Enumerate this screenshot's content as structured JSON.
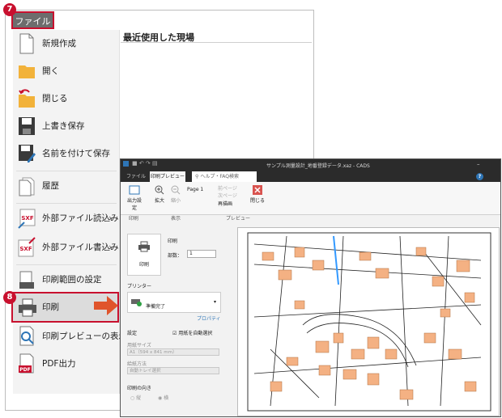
{
  "file_window": {
    "tab_label": "ファイル",
    "recent_heading": "最近使用した現場",
    "menu_items": [
      {
        "label": "新規作成",
        "icon": "new-document-icon"
      },
      {
        "label": "開く",
        "icon": "folder-icon"
      },
      {
        "label": "閉じる",
        "icon": "close-folder-icon"
      },
      {
        "label": "上書き保存",
        "icon": "save-icon"
      },
      {
        "label": "名前を付けて保存",
        "icon": "save-as-icon"
      },
      {
        "label": "履歴",
        "icon": "history-icon"
      },
      {
        "label": "外部ファイル読込み",
        "icon": "sxf-import-icon",
        "arrow": "›"
      },
      {
        "label": "外部ファイル書込み",
        "icon": "sxf-export-icon",
        "arrow": "›"
      },
      {
        "label": "印刷範囲の設定",
        "icon": "print-range-icon"
      },
      {
        "label": "印刷",
        "icon": "printer-icon"
      },
      {
        "label": "印刷プレビューの表示",
        "icon": "print-preview-icon"
      },
      {
        "label": "PDF出力",
        "icon": "pdf-icon"
      }
    ],
    "sxf_label": "SXF",
    "pdf_label": "PDF"
  },
  "badges": {
    "step7": "7",
    "step8": "8"
  },
  "cad_window": {
    "title": "サンプル測量設計_地番登録データ.xaz - CADS",
    "help_badge": "?",
    "tabs": [
      {
        "label": "ファイル"
      },
      {
        "label": "印刷プレビュー"
      },
      {
        "label": "ヘルプ・FAQ検索"
      }
    ],
    "ribbon": {
      "output_settings": "出力設定",
      "zoom_in": "拡大",
      "zoom_out": "縮小",
      "page": "Page 1",
      "prev_page": "前ページ",
      "next_page": "次ページ",
      "redraw": "再描画",
      "close": "閉じる",
      "group_print": "印刷",
      "group_view": "表示",
      "group_preview": "プレビュー"
    },
    "panel": {
      "print_label": "印刷",
      "print_button": "印刷",
      "copies_label": "部数：",
      "copies_value": "1",
      "printer_label": "プリンター",
      "printer_status": "準備完了",
      "properties": "プロパティ",
      "settings_label": "設定",
      "auto_select": "用紙を自動選択",
      "paper_size_label": "用紙サイズ",
      "paper_size_value": "A1（594 x 841 mm）",
      "feed_label": "給紙方法",
      "feed_value": "自動トレイ選択",
      "orientation_label": "印刷の向き",
      "portrait": "縦",
      "landscape": "横"
    }
  },
  "colors": {
    "accent_red": "#c8102e",
    "arrow_orange": "#e0542b",
    "building": "#f4b183",
    "folder": "#f2b23a"
  }
}
